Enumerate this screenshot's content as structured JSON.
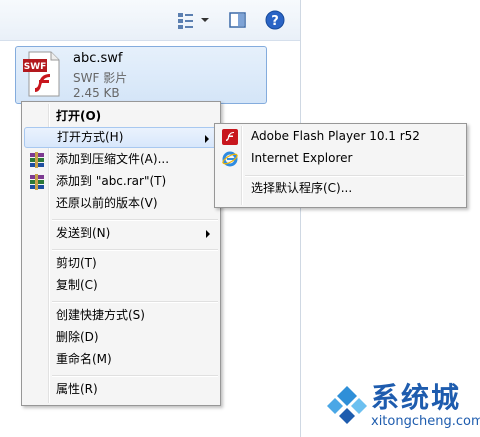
{
  "file": {
    "name": "abc.swf",
    "type": "SWF 影片",
    "size": "2.45 KB"
  },
  "context_menu": {
    "open": "打开(O)",
    "open_with": "打开方式(H)",
    "add_to_archive": "添加到压缩文件(A)...",
    "add_to_rar": "添加到 \"abc.rar\"(T)",
    "restore_versions": "还原以前的版本(V)",
    "send_to": "发送到(N)",
    "cut": "剪切(T)",
    "copy": "复制(C)",
    "create_shortcut": "创建快捷方式(S)",
    "delete": "删除(D)",
    "rename": "重命名(M)",
    "properties": "属性(R)"
  },
  "submenu": {
    "flash_player": "Adobe Flash Player 10.1 r52",
    "internet_explorer": "Internet Explorer",
    "choose_default": "选择默认程序(C)..."
  },
  "watermark": {
    "brand": "系统城",
    "url": "xitongcheng.com"
  },
  "colors": {
    "accent": "#1e5cae",
    "flash": "#c8161d",
    "selection": "#d4e5f8"
  }
}
